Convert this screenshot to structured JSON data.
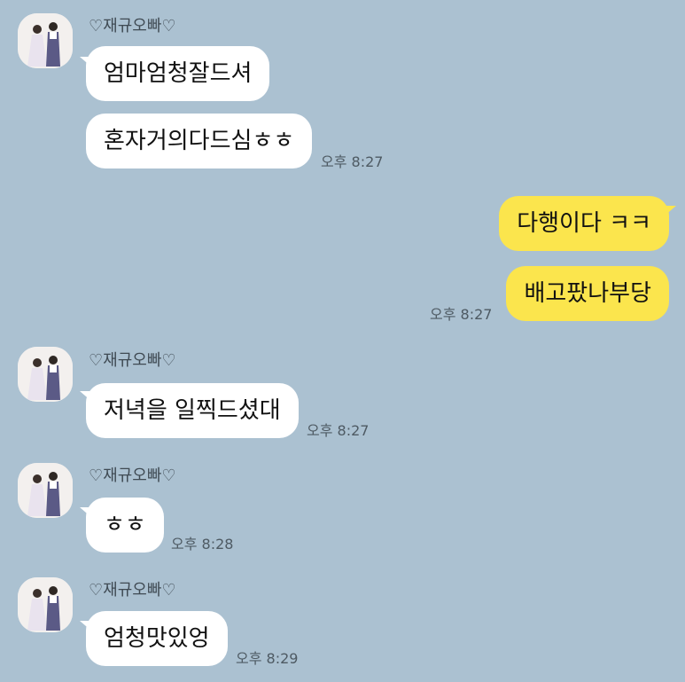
{
  "chat": {
    "sender_name": "♡재규오빠♡",
    "groups": [
      {
        "messages": [
          "엄마엄청잘드셔",
          "혼자거의다드심ㅎㅎ"
        ],
        "time": "오후 8:27"
      },
      {
        "messages": [
          "다행이다 ㅋㅋ",
          "배고팠나부당"
        ],
        "time": "오후 8:27"
      },
      {
        "messages": [
          "저녁을 일찍드셨대"
        ],
        "time": "오후 8:27"
      },
      {
        "messages": [
          "ㅎㅎ"
        ],
        "time": "오후 8:28"
      },
      {
        "messages": [
          "엄청맛있엉"
        ],
        "time": "오후 8:29"
      }
    ]
  },
  "colors": {
    "background": "#abc1d1",
    "incoming_bubble": "#ffffff",
    "outgoing_bubble": "#fbe54d"
  },
  "icons": {
    "avatar": "wedding-couple-photo"
  }
}
